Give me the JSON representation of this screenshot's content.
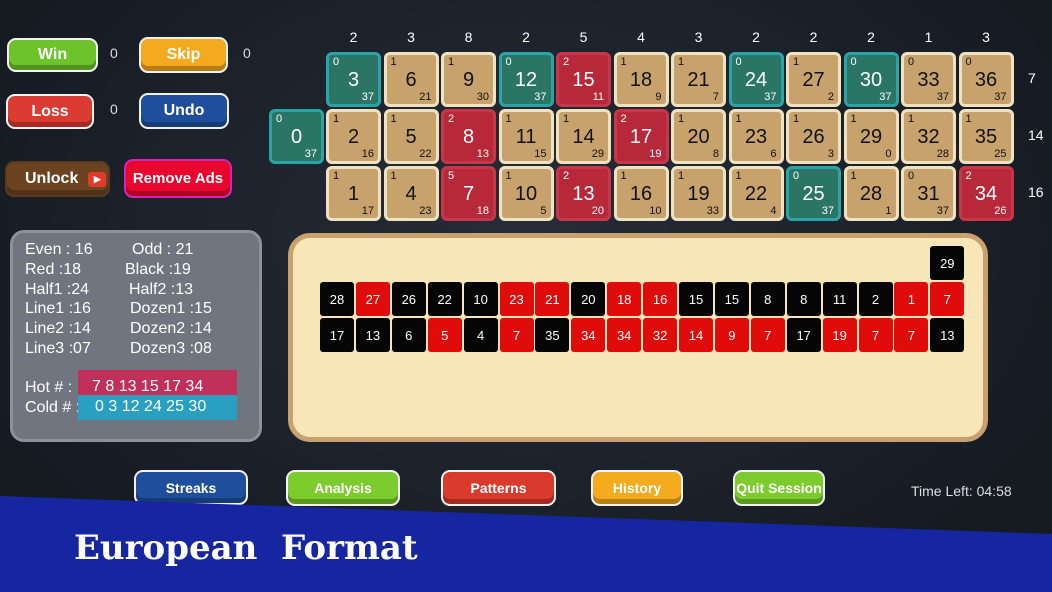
{
  "controls": {
    "win": {
      "label": "Win",
      "count": "0"
    },
    "skip": {
      "label": "Skip",
      "count": "0"
    },
    "loss": {
      "label": "Loss",
      "count": "0"
    },
    "undo": {
      "label": "Undo"
    },
    "unlock": {
      "label": "Unlock"
    },
    "remove_ads": {
      "label": "Remove Ads"
    }
  },
  "board": {
    "column_counts": [
      "2",
      "3",
      "8",
      "2",
      "5",
      "4",
      "3",
      "2",
      "2",
      "2",
      "1",
      "3"
    ],
    "row_counts": [
      "7",
      "14",
      "16"
    ],
    "zero": {
      "n": "0",
      "count": "0",
      "gap": "37",
      "color": "g"
    },
    "rows": [
      [
        [
          "3",
          "0",
          "37",
          "g"
        ],
        [
          "6",
          "1",
          "21",
          "t"
        ],
        [
          "9",
          "1",
          "30",
          "t"
        ],
        [
          "12",
          "0",
          "37",
          "g"
        ],
        [
          "15",
          "2",
          "11",
          "r"
        ],
        [
          "18",
          "1",
          "9",
          "t"
        ],
        [
          "21",
          "1",
          "7",
          "t"
        ],
        [
          "24",
          "0",
          "37",
          "g"
        ],
        [
          "27",
          "1",
          "2",
          "t"
        ],
        [
          "30",
          "0",
          "37",
          "g"
        ],
        [
          "33",
          "0",
          "37",
          "t"
        ],
        [
          "36",
          "0",
          "37",
          "t"
        ]
      ],
      [
        [
          "2",
          "1",
          "16",
          "t"
        ],
        [
          "5",
          "1",
          "22",
          "t"
        ],
        [
          "8",
          "2",
          "13",
          "r"
        ],
        [
          "11",
          "1",
          "15",
          "t"
        ],
        [
          "14",
          "1",
          "29",
          "t"
        ],
        [
          "17",
          "2",
          "19",
          "r"
        ],
        [
          "20",
          "1",
          "8",
          "t"
        ],
        [
          "23",
          "1",
          "6",
          "t"
        ],
        [
          "26",
          "1",
          "3",
          "t"
        ],
        [
          "29",
          "1",
          "0",
          "t"
        ],
        [
          "32",
          "1",
          "28",
          "t"
        ],
        [
          "35",
          "1",
          "25",
          "t"
        ]
      ],
      [
        [
          "1",
          "1",
          "17",
          "t"
        ],
        [
          "4",
          "1",
          "23",
          "t"
        ],
        [
          "7",
          "5",
          "18",
          "r"
        ],
        [
          "10",
          "1",
          "5",
          "t"
        ],
        [
          "13",
          "2",
          "20",
          "r"
        ],
        [
          "16",
          "1",
          "10",
          "t"
        ],
        [
          "19",
          "1",
          "33",
          "t"
        ],
        [
          "22",
          "1",
          "4",
          "t"
        ],
        [
          "25",
          "0",
          "37",
          "g"
        ],
        [
          "28",
          "1",
          "1",
          "t"
        ],
        [
          "31",
          "0",
          "37",
          "t"
        ],
        [
          "34",
          "2",
          "26",
          "r"
        ]
      ]
    ]
  },
  "stats": {
    "even": "Even : 16",
    "odd": "Odd :  21",
    "red": "Red :18",
    "black": "Black :19",
    "half1": "Half1 :24",
    "half2": "Half2 :13",
    "line1": "Line1 :16",
    "dozen1": "Dozen1 :15",
    "line2": "Line2 :14",
    "dozen2": "Dozen2 :14",
    "line3": "Line3 :07",
    "dozen3": "Dozen3 :08",
    "hot_label": "Hot # :",
    "hot_values": "7 8 13 15 17 34",
    "cold_label": "Cold # :",
    "cold_values": "0 3 12 24 25 30"
  },
  "history": {
    "top": [
      [
        "29",
        "b"
      ]
    ],
    "row1": [
      [
        "28",
        "b"
      ],
      [
        "27",
        "r"
      ],
      [
        "26",
        "b"
      ],
      [
        "22",
        "b"
      ],
      [
        "10",
        "b"
      ],
      [
        "23",
        "r"
      ],
      [
        "21",
        "r"
      ],
      [
        "20",
        "b"
      ],
      [
        "18",
        "r"
      ],
      [
        "16",
        "r"
      ],
      [
        "15",
        "b"
      ],
      [
        "15",
        "b"
      ],
      [
        "8",
        "b"
      ],
      [
        "8",
        "b"
      ],
      [
        "11",
        "b"
      ],
      [
        "2",
        "b"
      ],
      [
        "1",
        "r"
      ],
      [
        "7",
        "r"
      ]
    ],
    "row2": [
      [
        "17",
        "b"
      ],
      [
        "13",
        "b"
      ],
      [
        "6",
        "b"
      ],
      [
        "5",
        "r"
      ],
      [
        "4",
        "b"
      ],
      [
        "7",
        "r"
      ],
      [
        "35",
        "b"
      ],
      [
        "34",
        "r"
      ],
      [
        "34",
        "r"
      ],
      [
        "32",
        "r"
      ],
      [
        "14",
        "r"
      ],
      [
        "9",
        "r"
      ],
      [
        "7",
        "r"
      ],
      [
        "17",
        "b"
      ],
      [
        "19",
        "r"
      ],
      [
        "7",
        "r"
      ],
      [
        "7",
        "r"
      ],
      [
        "13",
        "b"
      ]
    ]
  },
  "nav": {
    "streaks": "Streaks",
    "analysis": "Analysis",
    "patterns": "Patterns",
    "history": "History",
    "quit": "Quit Session"
  },
  "timer": "Time Left: 04:58",
  "banner": "European  Format",
  "colors": {
    "tan": "#c8a26c",
    "green": "#2b7564",
    "red": "#b6283a",
    "banner": "#1626a0",
    "hot": "#c0305a",
    "cold": "#2aa0c0"
  }
}
